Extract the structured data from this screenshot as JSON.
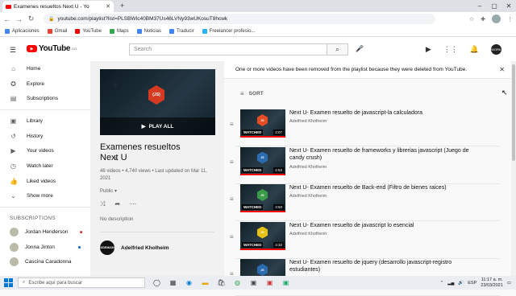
{
  "browser": {
    "tab_title": "Examenes resueltos Next U - Yo",
    "new_tab": "+",
    "url": "youtube.com/playlist?list=PLSBWIc40BM37Us46LVNy93wUKosuT8hcwk",
    "bookmarks": [
      {
        "label": "Aplicaciones",
        "color": "#4285f4"
      },
      {
        "label": "Gmail",
        "color": "#ea4335"
      },
      {
        "label": "YouTube",
        "color": "#ff0000"
      },
      {
        "label": "Maps",
        "color": "#34a853"
      },
      {
        "label": "Noticias",
        "color": "#4285f4"
      },
      {
        "label": "Traducir",
        "color": "#4285f4"
      },
      {
        "label": "Freelancer profesio...",
        "color": "#29b2fe"
      }
    ]
  },
  "header": {
    "logo_text": "YouTube",
    "logo_region": "CO",
    "search_placeholder": "Search",
    "avatar_text": "WORK"
  },
  "sidebar": {
    "primary": [
      {
        "label": "Home",
        "icon": "home-icon",
        "glyph": "⌂"
      },
      {
        "label": "Explore",
        "icon": "compass-icon",
        "glyph": "✪"
      },
      {
        "label": "Subscriptions",
        "icon": "subscriptions-icon",
        "glyph": "▤"
      }
    ],
    "secondary": [
      {
        "label": "Library",
        "icon": "library-icon",
        "glyph": "▣"
      },
      {
        "label": "History",
        "icon": "history-icon",
        "glyph": "↺"
      },
      {
        "label": "Your videos",
        "icon": "your-videos-icon",
        "glyph": "▶"
      },
      {
        "label": "Watch later",
        "icon": "clock-icon",
        "glyph": "◷"
      },
      {
        "label": "Liked videos",
        "icon": "thumb-up-icon",
        "glyph": "👍"
      },
      {
        "label": "Show more",
        "icon": "chevron-down-icon",
        "glyph": "⌄"
      }
    ],
    "subscriptions_title": "SUBSCRIPTIONS",
    "subscriptions": [
      {
        "label": "Jordan Henderson",
        "marker": "flag"
      },
      {
        "label": "Jonna Jinton",
        "marker": "dot"
      },
      {
        "label": "Cascina Caradonna",
        "marker": "none"
      }
    ]
  },
  "playlist": {
    "thumb_badge": "{JS}",
    "play_all": "PLAY ALL",
    "title": "Examenes resueltos Next U",
    "meta": "46 videos • 4,740 views • Last updated on Mar 11, 2021",
    "privacy": "Public",
    "no_description": "No description",
    "owner": "Adelfried Kholheim",
    "owner_avatar": "CODEMAGIC"
  },
  "main": {
    "notice": "One or more videos have been removed from the playlist because they were deleted from YouTube.",
    "sort_label": "SORT",
    "videos": [
      {
        "title": "Next U- Examen resuelto de javascript-la calculadora",
        "channel": "Adelfried Kholheim",
        "status": "WATCHED",
        "duration": "2:07",
        "badge": "JS",
        "badge_color": "#e44d26",
        "progress": 1.0
      },
      {
        "title": "Next U- Examen resuelto de frameworks y librerias javascript (Juego de candy crush)",
        "channel": "Adelfried Kholheim",
        "status": "WATCHED",
        "duration": "2:53",
        "badge": "JS",
        "badge_color": "#2b6cb0",
        "progress": 1.0
      },
      {
        "title": "Next U- Examen resuelto de Back-end (Filtro de bienes raices)",
        "channel": "Adelfried Kholheim",
        "status": "WATCHED",
        "duration": "3:50",
        "badge": "JS",
        "badge_color": "#3a9b4a",
        "progress": 1.0
      },
      {
        "title": "Next U- Examen resuelto de javascript lo esencial",
        "channel": "Adelfried Kholheim",
        "status": "WATCHED",
        "duration": "3:32",
        "badge": "JS",
        "badge_color": "#e5c218",
        "progress": 1.0
      },
      {
        "title": "Next U- Examen resuelto de jquery (desarrollo javascript-registro estudiantes)",
        "channel": "Adelfried Kholheim",
        "status": "",
        "duration": "",
        "badge": "JS",
        "badge_color": "#2b6cb0",
        "progress": 0
      }
    ]
  },
  "taskbar": {
    "search_placeholder": "Escribe aquí para buscar",
    "language": "ESP",
    "time": "11:17 a. m.",
    "date": "23/03/2021"
  }
}
